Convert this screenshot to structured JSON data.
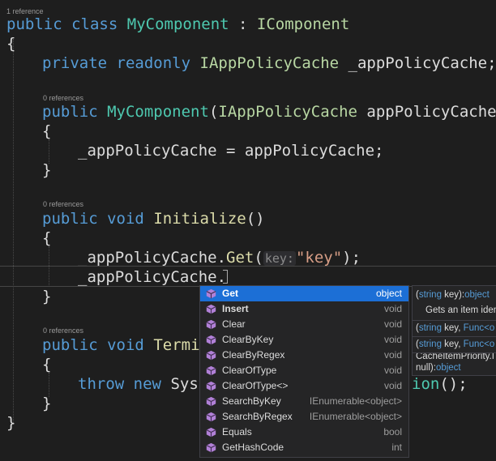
{
  "codelens": {
    "class_refs": "1 reference",
    "ctor_refs": "0 references",
    "init_refs": "0 references",
    "term_refs": "0 references"
  },
  "code": {
    "l1_public": "public",
    "l1_class": "class",
    "l1_name": "MyComponent",
    "l1_colon": " : ",
    "l1_iface": "IComponent",
    "open_brace": "{",
    "close_brace": "}",
    "l3_private": "private",
    "l3_readonly": "readonly",
    "l3_type": "IAppPolicyCache",
    "l3_field": " _appPolicyCache;",
    "l5_public": "public",
    "l5_name": "MyComponent",
    "l5_paren": "(",
    "l5_type": "IAppPolicyCache",
    "l5_param": " appPolicyCache)",
    "l7_assign": "_appPolicyCache = appPolicyCache;",
    "l10_public": "public",
    "l10_void": "void",
    "l10_method": "Initialize",
    "l10_parens": "()",
    "l12_pre": "_appPolicyCache.",
    "l12_get": "Get",
    "l12_open": "(",
    "l12_hint": "key:",
    "l12_str": "\"key\"",
    "l12_close": ");",
    "l13_text": "_appPolicyCache.",
    "l16_public": "public",
    "l16_void": "void",
    "l16_method": "Termin",
    "l18_throw": "throw",
    "l18_new": "new",
    "l18_sys": "Syst",
    "l18_ion": "ion",
    "l18_end": "();"
  },
  "completion": {
    "items": [
      {
        "name": "Get",
        "type": "object"
      },
      {
        "name": "Insert",
        "type": "void"
      },
      {
        "name": "Clear",
        "type": "void"
      },
      {
        "name": "ClearByKey",
        "type": "void"
      },
      {
        "name": "ClearByRegex",
        "type": "void"
      },
      {
        "name": "ClearOfType",
        "type": "void"
      },
      {
        "name": "ClearOfType<>",
        "type": "void"
      },
      {
        "name": "SearchByKey",
        "type": "IEnumerable<object>"
      },
      {
        "name": "SearchByRegex",
        "type": "IEnumerable<object>"
      },
      {
        "name": "Equals",
        "type": "bool"
      },
      {
        "name": "GetHashCode",
        "type": "int"
      }
    ],
    "selected_index": 0,
    "icon_color": "#b180d7"
  },
  "tooltip": {
    "sig1_open": "(",
    "sig1_kw": "string",
    "sig1_rest": " key):",
    "sig1_ret": "object",
    "desc": "Gets an item iden",
    "sig2_open": "(",
    "sig2_kw": "string",
    "sig2_rest": " key, ",
    "sig2_func": "Func<o",
    "sig3_open": "(",
    "sig3_kw": "string",
    "sig3_rest": " key, ",
    "sig3_func": "Func<o",
    "sig3_line2": "CacheItemPriority.I",
    "sig3_line3_pre": "null):",
    "sig3_line3_ret": "object"
  }
}
